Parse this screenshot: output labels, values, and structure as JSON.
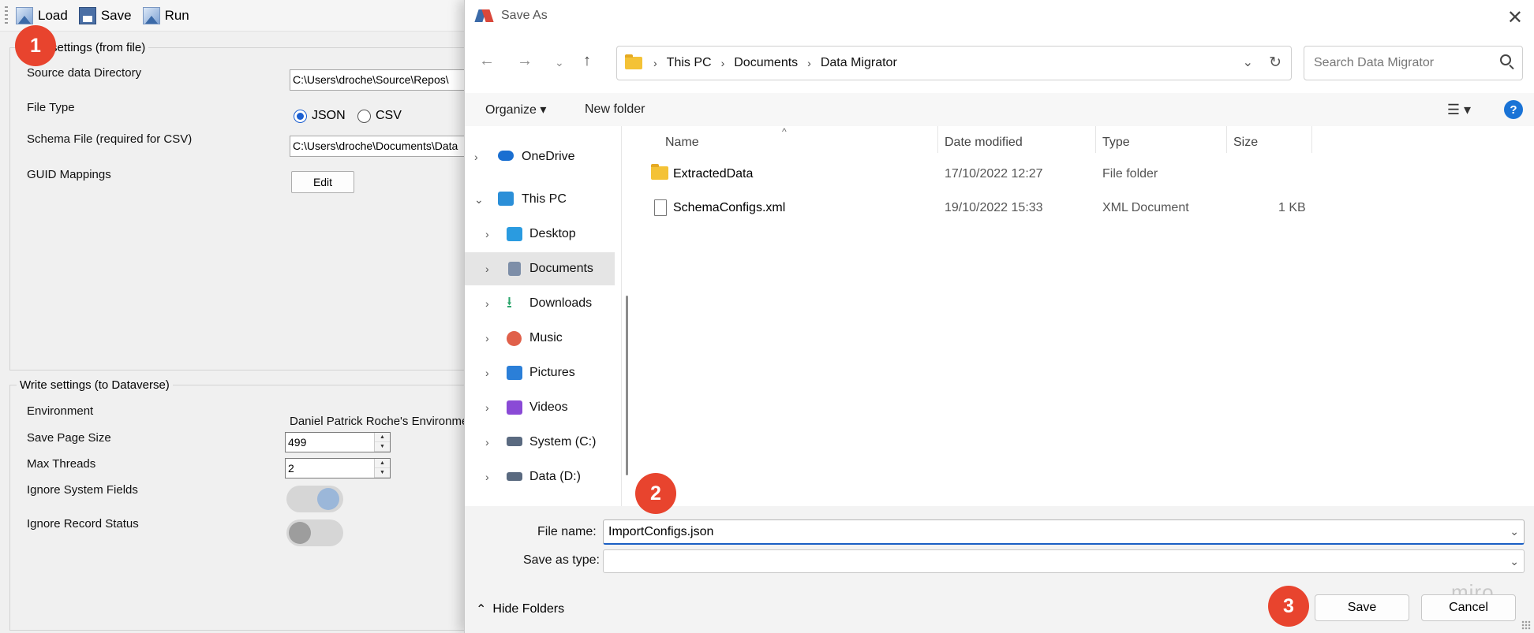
{
  "toolbar": {
    "load": "Load",
    "save": "Save",
    "run": "Run"
  },
  "read_settings": {
    "legend": "Read settings (from file)",
    "source_label": "Source data Directory",
    "source_value": "C:\\Users\\droche\\Source\\Repos\\",
    "filetype_label": "File Type",
    "json_label": "JSON",
    "csv_label": "CSV",
    "schema_label": "Schema File (required for CSV)",
    "schema_value": "C:\\Users\\droche\\Documents\\Data",
    "guid_label": "GUID Mappings",
    "edit_label": "Edit"
  },
  "write_settings": {
    "legend": "Write settings (to Dataverse)",
    "env_label": "Environment",
    "env_value": "Daniel Patrick Roche's Environment",
    "page_label": "Save Page Size",
    "page_value": "499",
    "threads_label": "Max Threads",
    "threads_value": "2",
    "ignore_sys_label": "Ignore System Fields",
    "ignore_sys_on": true,
    "ignore_rec_label": "Ignore Record Status",
    "ignore_rec_on": false
  },
  "badges": {
    "one": "1",
    "two": "2",
    "three": "3"
  },
  "dialog": {
    "title": "Save As",
    "breadcrumb": [
      "This PC",
      "Documents",
      "Data Migrator"
    ],
    "search_placeholder": "Search Data Migrator",
    "organize": "Organize ▾",
    "new_folder": "New folder",
    "nav_items": [
      {
        "label": "OneDrive",
        "icon": "cloud-icon",
        "color": "#1a6fd1"
      },
      {
        "label": "This PC",
        "icon": "computer-icon",
        "color": "#2b8fd8"
      },
      {
        "label": "Desktop",
        "icon": "desktop-icon",
        "color": "#2a9be0"
      },
      {
        "label": "Documents",
        "icon": "documents-icon",
        "color": "#7d8ea8"
      },
      {
        "label": "Downloads",
        "icon": "download-icon",
        "color": "#2aa56b"
      },
      {
        "label": "Music",
        "icon": "music-icon",
        "color": "#e0604a"
      },
      {
        "label": "Pictures",
        "icon": "pictures-icon",
        "color": "#2b7fd8"
      },
      {
        "label": "Videos",
        "icon": "videos-icon",
        "color": "#8a4ad6"
      },
      {
        "label": "System (C:)",
        "icon": "drive-icon",
        "color": "#5a6a80"
      },
      {
        "label": "Data (D:)",
        "icon": "drive-icon",
        "color": "#5a6a80"
      }
    ],
    "columns": {
      "name": "Name",
      "date": "Date modified",
      "type": "Type",
      "size": "Size"
    },
    "files": [
      {
        "name": "ExtractedData",
        "date": "17/10/2022 12:27",
        "type": "File folder",
        "size": "",
        "icon": "folder-icon"
      },
      {
        "name": "SchemaConfigs.xml",
        "date": "19/10/2022 15:33",
        "type": "XML Document",
        "size": "1 KB",
        "icon": "file-icon"
      }
    ],
    "file_name_label": "File name:",
    "file_name_value": "ImportConfigs.json",
    "save_type_label": "Save as type:",
    "save_type_value": "",
    "hide_folders": "Hide Folders",
    "save_button": "Save",
    "cancel_button": "Cancel",
    "watermark": "miro"
  }
}
